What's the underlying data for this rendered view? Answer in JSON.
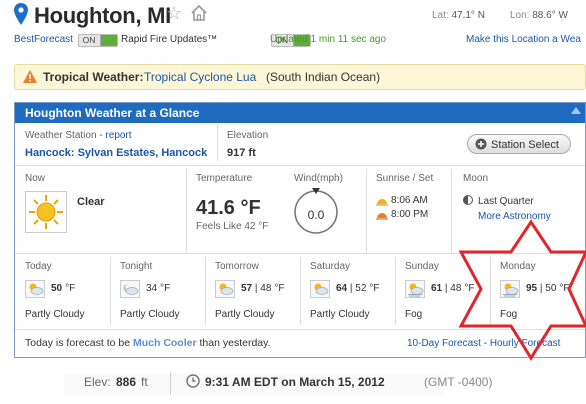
{
  "header": {
    "city": "Houghton, MI",
    "lat_label": "Lat:",
    "lat_value": "47.1° N",
    "lon_label": "Lon:",
    "lon_value": "88.6° W"
  },
  "options": {
    "best_forecast": "BestForecast",
    "best_forecast_toggle": "ON",
    "rapid_fire": "Rapid Fire Updates™",
    "rapid_fire_toggle": "ON",
    "updated": "Updated 1 min 11 sec ago",
    "make_location": "Make this Location a Wea"
  },
  "alert": {
    "label": "Tropical Weather:",
    "link": "Tropical Cyclone Lua",
    "detail": "(South Indian Ocean)"
  },
  "panel": {
    "title": "Houghton Weather at a Glance",
    "station_label": "Weather Station",
    "station_sep": " - ",
    "station_report": "report",
    "station_name": "Hancock: Sylvan Estates, Hancock",
    "elevation_label": "Elevation",
    "elevation_value": "917 ft",
    "station_select": "Station Select",
    "now_label": "Now",
    "now_condition": "Clear",
    "temp_label": "Temperature",
    "temp_value": "41.6 °F",
    "feels_like": "Feels Like 42 °F",
    "wind_label": "Wind(mph)",
    "wind_value": "0.0",
    "sun_label": "Sunrise / Set",
    "sunrise": "8:06 AM",
    "sunset": "8:00 PM",
    "moon_label": "Moon",
    "moon_phase": "Last Quarter",
    "more_astronomy": "More Astronomy",
    "forecast": [
      {
        "day": "Today",
        "high": "50",
        "low": "",
        "unit": "°F",
        "cond": "Partly Cloudy"
      },
      {
        "day": "Tonight",
        "high": "",
        "low": "34",
        "unit": "°F",
        "cond": "Partly Cloudy"
      },
      {
        "day": "Tomorrow",
        "high": "57",
        "low": "48",
        "unit": "°F",
        "cond": "Partly Cloudy"
      },
      {
        "day": "Saturday",
        "high": "64",
        "low": "52",
        "unit": "°F",
        "cond": "Partly Cloudy"
      },
      {
        "day": "Sunday",
        "high": "61",
        "low": "48",
        "unit": "°F",
        "cond": "Fog"
      },
      {
        "day": "Monday",
        "high": "95",
        "low": "50",
        "unit": "°F",
        "cond": "Fog"
      }
    ],
    "summary_pre": "Today is forecast to be",
    "summary_link": "Much Cooler",
    "summary_post": "than yesterday.",
    "ten_day": "10-Day Forecast",
    "hourly": "Hourly Forecast"
  },
  "footer": {
    "elev_label": "Elev:",
    "elev_value": "886",
    "elev_unit": "ft",
    "time": "9:31 AM EDT on March 15, 2012",
    "gmt": "(GMT -0400)"
  },
  "colors": {
    "panel_header": "#1f6bbf",
    "annotation_star": "#e0262b",
    "toggle_on": "#5fad3c",
    "updated_text": "#4a9a2a"
  }
}
